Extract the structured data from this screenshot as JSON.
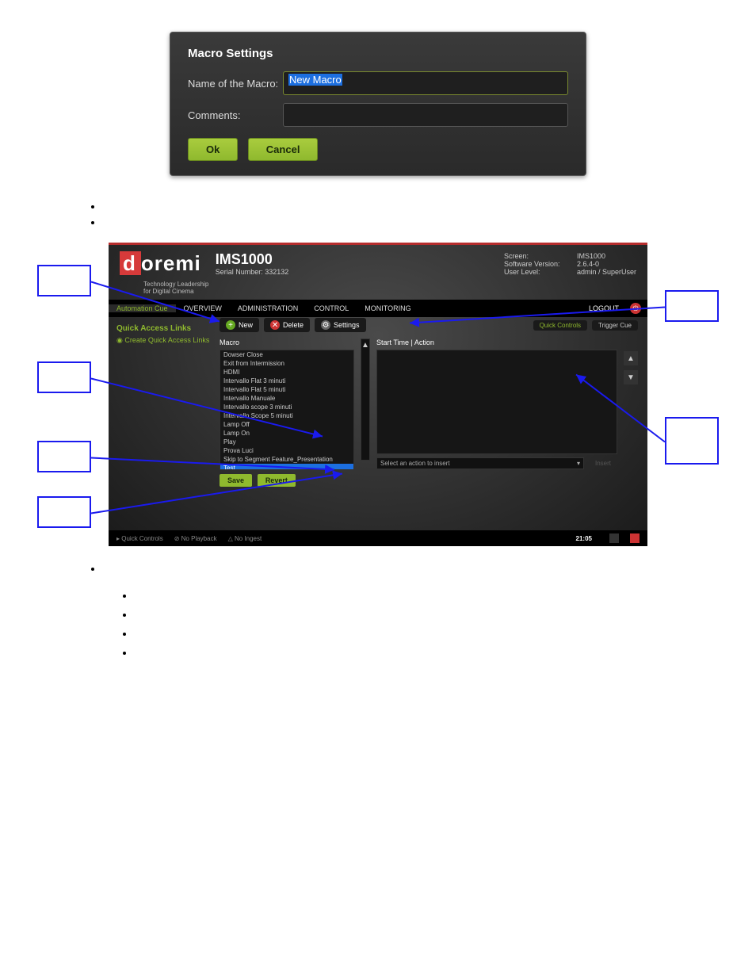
{
  "dialog": {
    "title": "Macro Settings",
    "name_label": "Name of the Macro:",
    "name_value": "New Macro",
    "comments_label": "Comments:",
    "comments_value": "",
    "ok": "Ok",
    "cancel": "Cancel"
  },
  "app": {
    "logo_d": "d",
    "logo_rest": "oremi",
    "product": "IMS1000",
    "serial": "Serial Number: 332132",
    "tagline_1": "Technology Leadership",
    "tagline_2": "for Digital Cinema",
    "sys": {
      "screen_k": "Screen:",
      "screen_v": "IMS1000",
      "sw_k": "Software Version:",
      "sw_v": "2.6.4-0",
      "user_k": "User Level:",
      "user_v": "admin / SuperUser"
    },
    "nav": {
      "active": "Automation Cue",
      "overview": "OVERVIEW",
      "administration": "ADMINISTRATION",
      "control": "CONTROL",
      "monitoring": "MONITORING",
      "logout": "LOGOUT"
    },
    "quick_links": {
      "title": "Quick Access Links",
      "create": "Create Quick Access Links"
    },
    "toolbar": {
      "new": "New",
      "delete": "Delete",
      "settings": "Settings",
      "quick_controls": "Quick Controls",
      "trigger_cue": "Trigger Cue"
    },
    "macro_list": {
      "header": "Macro",
      "items": [
        "Dowser Close",
        "Exit from Intermission",
        "HDMI",
        "Intervallo Flat 3 minuti",
        "Intervallo Flat 5 minuti",
        "Intervallo Manuale",
        "Intervallo scope 3 minuti",
        "Intervallo Scope 5 minuti",
        "Lamp Off",
        "Lamp On",
        "Play",
        "Prova Luci",
        "Skip to Segment Feature_Presentation",
        "Test"
      ],
      "selected_index": 13
    },
    "actions": {
      "header": "Start Time | Action",
      "select_placeholder": "Select an action to insert",
      "insert": "Insert"
    },
    "save": "Save",
    "revert": "Revert",
    "footer": {
      "quick_controls": "Quick Controls",
      "no_playback": "No Playback",
      "no_ingest": "No Ingest",
      "time": "21:05"
    }
  }
}
